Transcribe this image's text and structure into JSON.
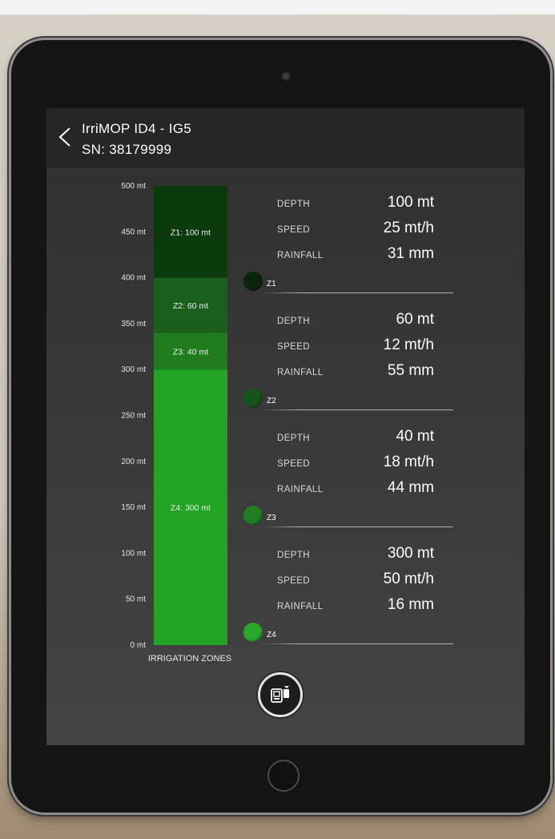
{
  "header": {
    "title": "IrriMOP ID4 - IG5",
    "serial": "SN: 38179999"
  },
  "chart_data": {
    "type": "bar",
    "orientation": "vertical-stacked",
    "xlabel": "IRRIGATION ZONES",
    "ylim": [
      0,
      500
    ],
    "unit": "mt",
    "ticks": [
      "500 mt",
      "450 mt",
      "400 mt",
      "350 mt",
      "300 mt",
      "250 mt",
      "200 mt",
      "150 mt",
      "100 mt",
      "50 mt",
      "0 mt"
    ],
    "segments": [
      {
        "label": "Z1: 100 mt",
        "value": 100,
        "color": "#0b3a0d"
      },
      {
        "label": "Z2: 60 mt",
        "value": 60,
        "color": "#1a5f1c"
      },
      {
        "label": "Z3: 40 mt",
        "value": 40,
        "color": "#1e7c1f"
      },
      {
        "label": "Z4: 300 mt",
        "value": 300,
        "color": "#22a323"
      }
    ]
  },
  "zones": [
    {
      "name": "Z1",
      "depth_label": "DEPTH",
      "depth": "100 mt",
      "speed_label": "SPEED",
      "speed": "25 mt/h",
      "rainfall_label": "RAINFALL",
      "rainfall": "31 mm",
      "dot_color": "#0a250b"
    },
    {
      "name": "Z2",
      "depth_label": "DEPTH",
      "depth": "60 mt",
      "speed_label": "SPEED",
      "speed": "12 mt/h",
      "rainfall_label": "RAINFALL",
      "rainfall": "55 mm",
      "dot_color": "#15541a"
    },
    {
      "name": "Z3",
      "depth_label": "DEPTH",
      "depth": "40 mt",
      "speed_label": "SPEED",
      "speed": "18 mt/h",
      "rainfall_label": "RAINFALL",
      "rainfall": "44 mm",
      "dot_color": "#1f7f22"
    },
    {
      "name": "Z4",
      "depth_label": "DEPTH",
      "depth": "300 mt",
      "speed_label": "SPEED",
      "speed": "50 mt/h",
      "rainfall_label": "RAINFALL",
      "rainfall": "16 mm",
      "dot_color": "#2aa82b"
    }
  ],
  "icons": {
    "back": "chevron-left-icon",
    "compare": "id-compare-icon"
  }
}
